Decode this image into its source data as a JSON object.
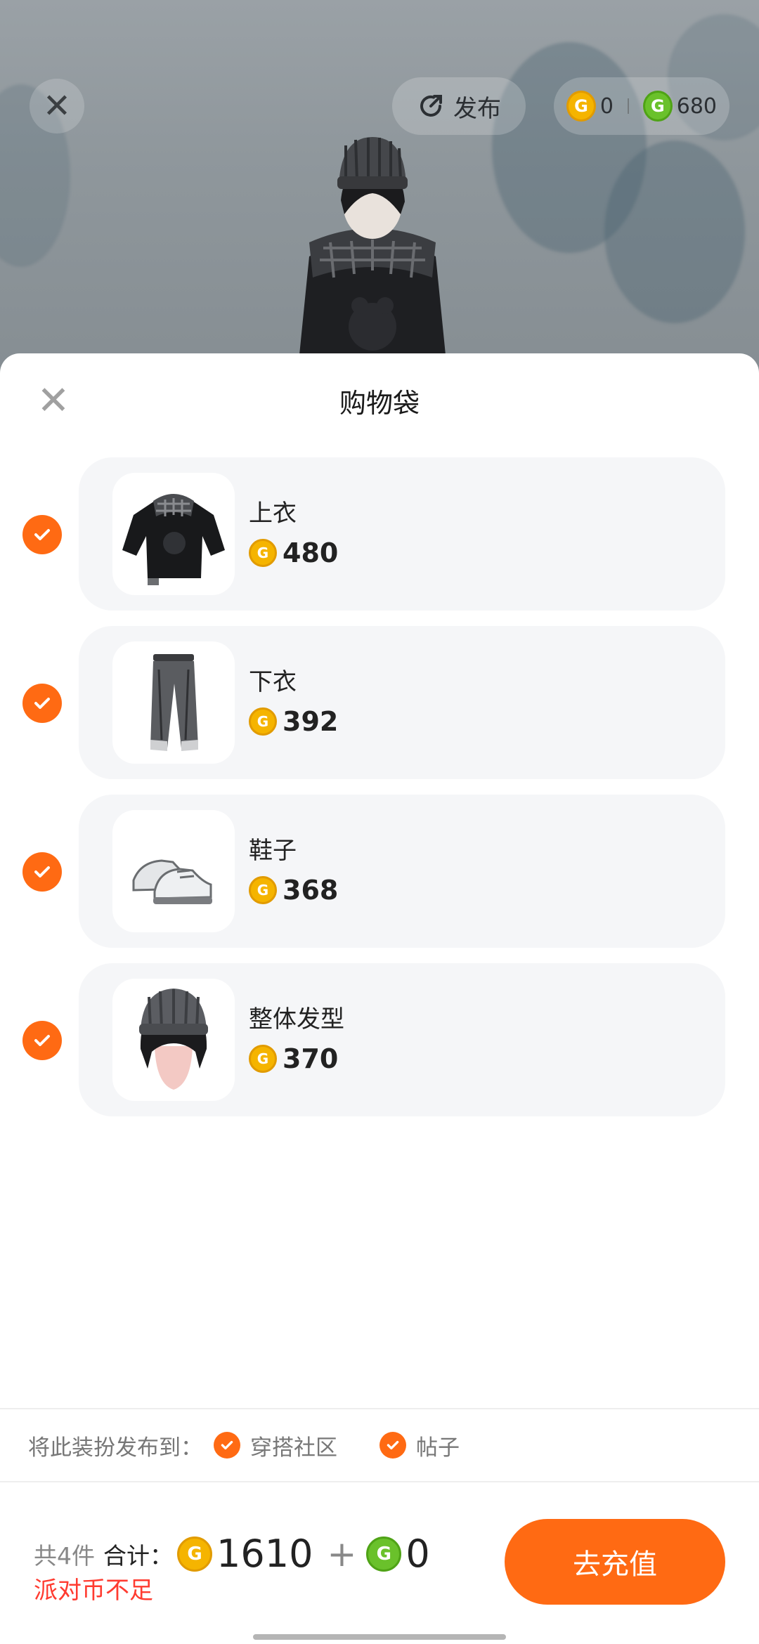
{
  "topbar": {
    "publish_label": "发布",
    "gold_balance": "0",
    "green_balance": "680"
  },
  "sheet": {
    "title": "购物袋",
    "items": [
      {
        "name": "上衣",
        "price": "480",
        "checked": true,
        "thumb": "top-clothing"
      },
      {
        "name": "下衣",
        "price": "392",
        "checked": true,
        "thumb": "pants"
      },
      {
        "name": "鞋子",
        "price": "368",
        "checked": true,
        "thumb": "shoes"
      },
      {
        "name": "整体发型",
        "price": "370",
        "checked": true,
        "thumb": "hairstyle"
      }
    ]
  },
  "publish_to": {
    "label": "将此装扮发布到：",
    "options": [
      "穿搭社区",
      "帖子"
    ]
  },
  "footer": {
    "count_text": "共4件",
    "total_label": "合计：",
    "gold_total": "1610",
    "plus": "+",
    "green_total": "0",
    "warning": "派对币不足",
    "recharge_label": "去充值"
  },
  "colors": {
    "accent": "#ff6a13",
    "gold_coin": "#f5b400",
    "green_coin": "#6ac12b",
    "warning": "#ff3b30",
    "card_bg": "#f5f6f8"
  },
  "icons": {
    "close": "close-icon",
    "publish": "refresh-publish-icon",
    "check": "check-icon"
  }
}
